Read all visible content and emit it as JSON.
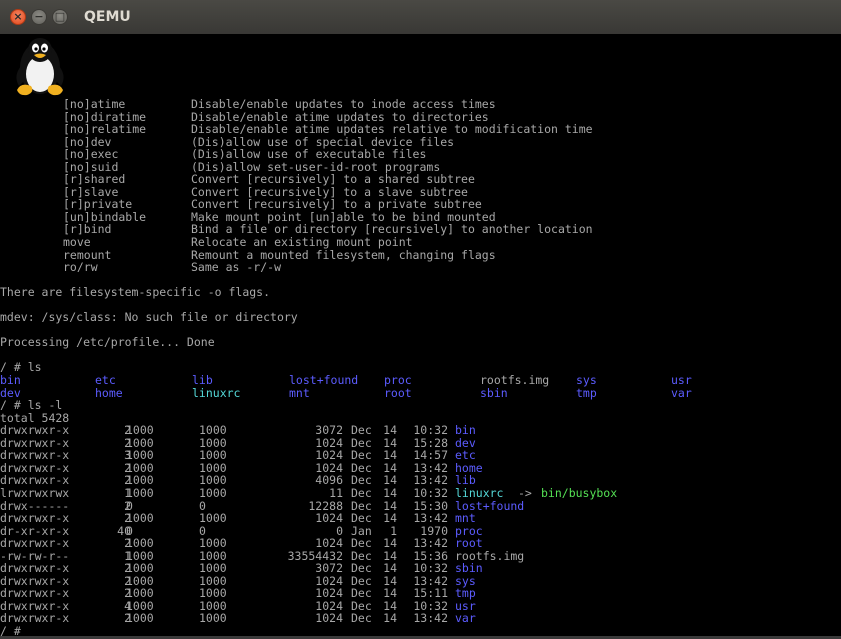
{
  "window": {
    "title": "QEMU",
    "close_glyph": "×",
    "minimize_glyph": "−",
    "maximize_glyph": "□"
  },
  "colors": {
    "text": "#a8a8a8",
    "directory": "#5c5cff",
    "symlink": "#54d8d8",
    "executable_target": "#54e054",
    "background": "#000000"
  },
  "boot_logo": "tux-penguin-icon",
  "mount_options": [
    {
      "opt": "[no]atime",
      "desc": "Disable/enable updates to inode access times"
    },
    {
      "opt": "[no]diratime",
      "desc": "Disable/enable atime updates to directories"
    },
    {
      "opt": "[no]relatime",
      "desc": "Disable/enable atime updates relative to modification time"
    },
    {
      "opt": "[no]dev",
      "desc": "(Dis)allow use of special device files"
    },
    {
      "opt": "[no]exec",
      "desc": "(Dis)allow use of executable files"
    },
    {
      "opt": "[no]suid",
      "desc": "(Dis)allow set-user-id-root programs"
    },
    {
      "opt": "[r]shared",
      "desc": "Convert [recursively] to a shared subtree"
    },
    {
      "opt": "[r]slave",
      "desc": "Convert [recursively] to a slave subtree"
    },
    {
      "opt": "[r]private",
      "desc": "Convert [recursively] to a private subtree"
    },
    {
      "opt": "[un]bindable",
      "desc": "Make mount point [un]able to be bind mounted"
    },
    {
      "opt": "[r]bind",
      "desc": "Bind a file or directory [recursively] to another location"
    },
    {
      "opt": "move",
      "desc": "Relocate an existing mount point"
    },
    {
      "opt": "remount",
      "desc": "Remount a mounted filesystem, changing flags"
    },
    {
      "opt": "ro/rw",
      "desc": "Same as -r/-w"
    }
  ],
  "messages": {
    "fs_flags": "There are filesystem-specific -o flags.",
    "mdev": "mdev: /sys/class: No such file or directory",
    "profile": "Processing /etc/profile... Done"
  },
  "ls": {
    "prompt": "/ # ls",
    "row1": [
      {
        "name": "bin",
        "type": "dir"
      },
      {
        "name": "etc",
        "type": "dir"
      },
      {
        "name": "lib",
        "type": "dir"
      },
      {
        "name": "lost+found",
        "type": "dir"
      },
      {
        "name": "proc",
        "type": "dir"
      },
      {
        "name": "rootfs.img",
        "type": "file"
      },
      {
        "name": "sys",
        "type": "dir"
      },
      {
        "name": "usr",
        "type": "dir"
      }
    ],
    "row2": [
      {
        "name": "dev",
        "type": "dir"
      },
      {
        "name": "home",
        "type": "dir"
      },
      {
        "name": "linuxrc",
        "type": "link"
      },
      {
        "name": "mnt",
        "type": "dir"
      },
      {
        "name": "root",
        "type": "dir"
      },
      {
        "name": "sbin",
        "type": "dir"
      },
      {
        "name": "tmp",
        "type": "dir"
      },
      {
        "name": "var",
        "type": "dir"
      }
    ]
  },
  "ls_l": {
    "prompt": "/ # ls -l",
    "total": "total 5428",
    "rows": [
      {
        "perm": "drwxrwxr-x",
        "links": "2",
        "owner": "1000",
        "group": "1000",
        "size": "3072",
        "month": "Dec",
        "day": "14",
        "time": "10:32",
        "name": "bin",
        "type": "dir"
      },
      {
        "perm": "drwxrwxr-x",
        "links": "2",
        "owner": "1000",
        "group": "1000",
        "size": "1024",
        "month": "Dec",
        "day": "14",
        "time": "15:28",
        "name": "dev",
        "type": "dir"
      },
      {
        "perm": "drwxrwxr-x",
        "links": "3",
        "owner": "1000",
        "group": "1000",
        "size": "1024",
        "month": "Dec",
        "day": "14",
        "time": "14:57",
        "name": "etc",
        "type": "dir"
      },
      {
        "perm": "drwxrwxr-x",
        "links": "2",
        "owner": "1000",
        "group": "1000",
        "size": "1024",
        "month": "Dec",
        "day": "14",
        "time": "13:42",
        "name": "home",
        "type": "dir"
      },
      {
        "perm": "drwxrwxr-x",
        "links": "2",
        "owner": "1000",
        "group": "1000",
        "size": "4096",
        "month": "Dec",
        "day": "14",
        "time": "13:42",
        "name": "lib",
        "type": "dir"
      },
      {
        "perm": "lrwxrwxrwx",
        "links": "1",
        "owner": "1000",
        "group": "1000",
        "size": "11",
        "month": "Dec",
        "day": "14",
        "time": "10:32",
        "name": "linuxrc",
        "type": "link",
        "arrow": "->",
        "target": "bin/busybox"
      },
      {
        "perm": "drwx------",
        "links": "2",
        "owner": "0",
        "group": "0",
        "size": "12288",
        "month": "Dec",
        "day": "14",
        "time": "15:30",
        "name": "lost+found",
        "type": "dir"
      },
      {
        "perm": "drwxrwxr-x",
        "links": "2",
        "owner": "1000",
        "group": "1000",
        "size": "1024",
        "month": "Dec",
        "day": "14",
        "time": "13:42",
        "name": "mnt",
        "type": "dir"
      },
      {
        "perm": "dr-xr-xr-x",
        "links": "40",
        "owner": "0",
        "group": "0",
        "size": "0",
        "month": "Jan",
        "day": "1",
        "time": "1970",
        "name": "proc",
        "type": "dir"
      },
      {
        "perm": "drwxrwxr-x",
        "links": "2",
        "owner": "1000",
        "group": "1000",
        "size": "1024",
        "month": "Dec",
        "day": "14",
        "time": "13:42",
        "name": "root",
        "type": "dir"
      },
      {
        "perm": "-rw-rw-r--",
        "links": "1",
        "owner": "1000",
        "group": "1000",
        "size": "33554432",
        "month": "Dec",
        "day": "14",
        "time": "15:36",
        "name": "rootfs.img",
        "type": "file"
      },
      {
        "perm": "drwxrwxr-x",
        "links": "2",
        "owner": "1000",
        "group": "1000",
        "size": "3072",
        "month": "Dec",
        "day": "14",
        "time": "10:32",
        "name": "sbin",
        "type": "dir"
      },
      {
        "perm": "drwxrwxr-x",
        "links": "2",
        "owner": "1000",
        "group": "1000",
        "size": "1024",
        "month": "Dec",
        "day": "14",
        "time": "13:42",
        "name": "sys",
        "type": "dir"
      },
      {
        "perm": "drwxrwxr-x",
        "links": "2",
        "owner": "1000",
        "group": "1000",
        "size": "1024",
        "month": "Dec",
        "day": "14",
        "time": "15:11",
        "name": "tmp",
        "type": "dir"
      },
      {
        "perm": "drwxrwxr-x",
        "links": "4",
        "owner": "1000",
        "group": "1000",
        "size": "1024",
        "month": "Dec",
        "day": "14",
        "time": "10:32",
        "name": "usr",
        "type": "dir"
      },
      {
        "perm": "drwxrwxr-x",
        "links": "2",
        "owner": "1000",
        "group": "1000",
        "size": "1024",
        "month": "Dec",
        "day": "14",
        "time": "13:42",
        "name": "var",
        "type": "dir"
      }
    ]
  },
  "final_prompt": "/ #"
}
